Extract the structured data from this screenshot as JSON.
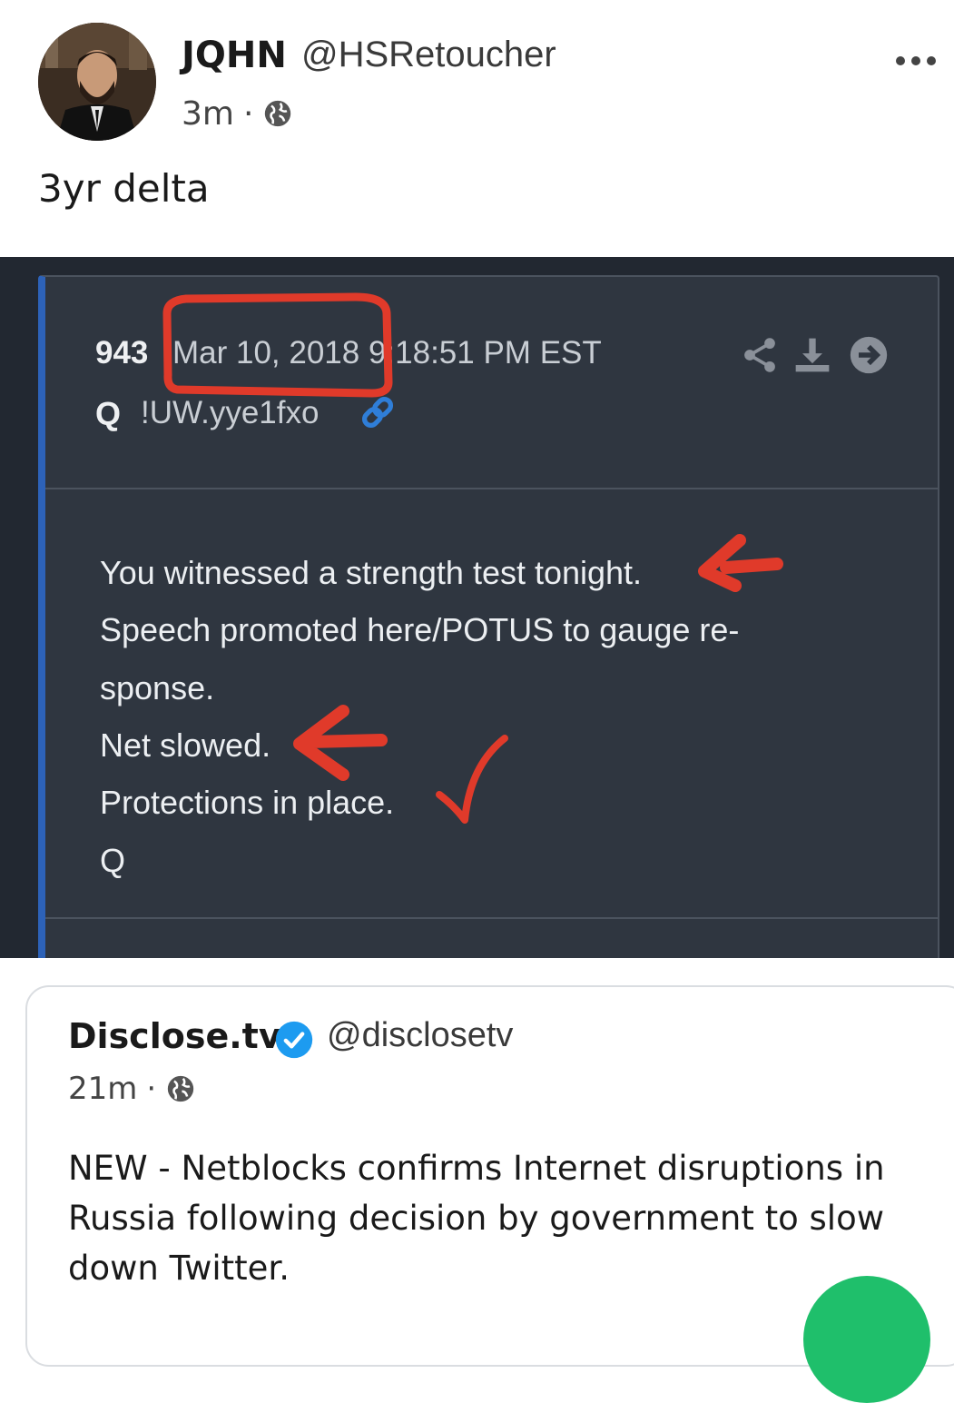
{
  "author": {
    "name": "JQHN",
    "handle": "@HSRetoucher",
    "time": "3m",
    "separator": "·"
  },
  "post": {
    "text": "3yr delta"
  },
  "embed": {
    "post_number": "943",
    "date": "Mar 10, 2018 9:18:51 PM EST",
    "poster_name": "Q",
    "tripcode": "!UW.yye1fxo",
    "body_lines": [
      "You witnessed a strength test tonight.",
      "Speech promoted here/POTUS to gauge re-",
      "sponse.",
      "Net slowed.",
      "Protections in place.",
      "Q"
    ],
    "annotation_color": "#e03a2a"
  },
  "quote": {
    "name": "Disclose.tv",
    "handle": "@disclosetv",
    "time": "21m",
    "separator": "·",
    "text": "NEW - Netblocks confirms Internet disruptions in Russia following decision by government to slow down Twitter."
  },
  "colors": {
    "verified": "#1d9bf0",
    "accent_green": "#1fbf6b",
    "embed_bg": "#222831",
    "card_bg": "#2f3640"
  },
  "icons": {
    "more": "more-dots-icon",
    "globe": "globe-icon",
    "share": "share-icon",
    "download": "download-icon",
    "forward": "arrow-circle-right-icon",
    "link": "link-icon",
    "verified": "verified-badge-icon"
  }
}
